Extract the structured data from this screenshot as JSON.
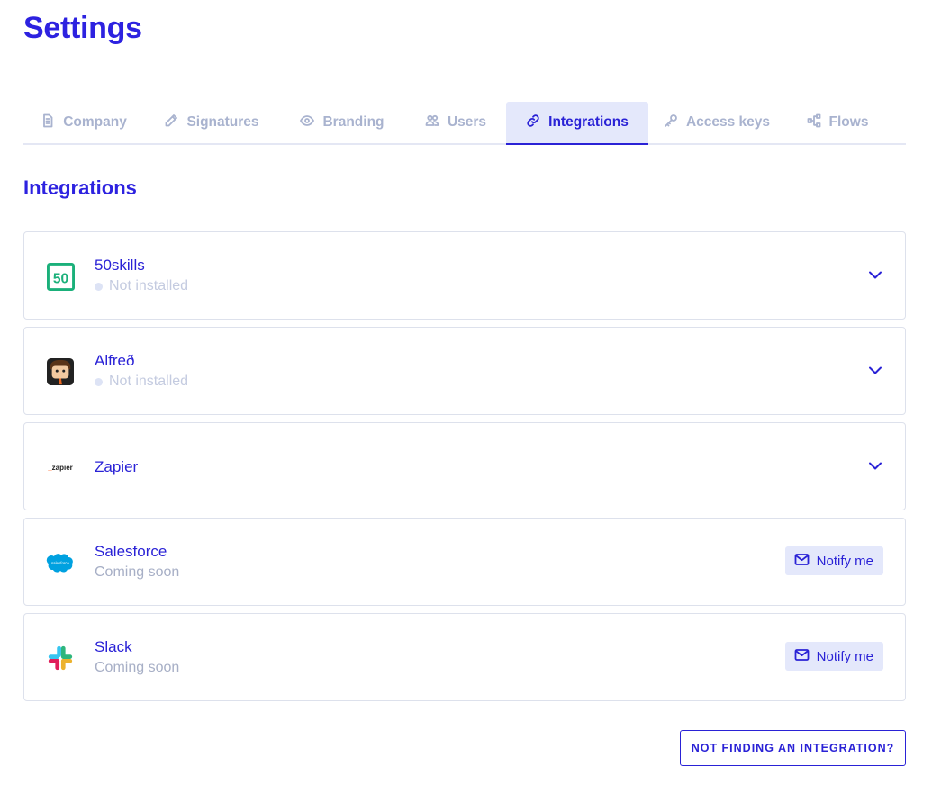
{
  "page": {
    "title": "Settings"
  },
  "tabs": [
    {
      "label": "Company",
      "icon": "document-icon"
    },
    {
      "label": "Signatures",
      "icon": "pencil-icon"
    },
    {
      "label": "Branding",
      "icon": "eye-icon"
    },
    {
      "label": "Users",
      "icon": "users-icon"
    },
    {
      "label": "Integrations",
      "icon": "link-icon",
      "active": true
    },
    {
      "label": "Access keys",
      "icon": "key-icon"
    },
    {
      "label": "Flows",
      "icon": "flow-icon"
    }
  ],
  "section": {
    "title": "Integrations"
  },
  "integrations": [
    {
      "name": "50skills",
      "status": "Not installed",
      "action": "expand",
      "logo": "50skills-logo"
    },
    {
      "name": "Alfreð",
      "status": "Not installed",
      "action": "expand",
      "logo": "alfred-logo"
    },
    {
      "name": "Zapier",
      "status": "",
      "action": "expand",
      "logo": "zapier-logo",
      "logo_text": "_zapier"
    },
    {
      "name": "Salesforce",
      "status": "Coming soon",
      "action": "notify",
      "action_label": "Notify me",
      "logo": "salesforce-logo",
      "logo_text": "salesforce"
    },
    {
      "name": "Slack",
      "status": "Coming soon",
      "action": "notify",
      "action_label": "Notify me",
      "logo": "slack-logo"
    }
  ],
  "footer": {
    "cta_label": "NOT FINDING AN INTEGRATION?"
  },
  "colors": {
    "accent": "#2a22d6",
    "tab_inactive": "#a9b3cf",
    "tab_active_bg": "#e4e8fb",
    "border": "#dde1ec",
    "muted": "#a7afc6"
  }
}
